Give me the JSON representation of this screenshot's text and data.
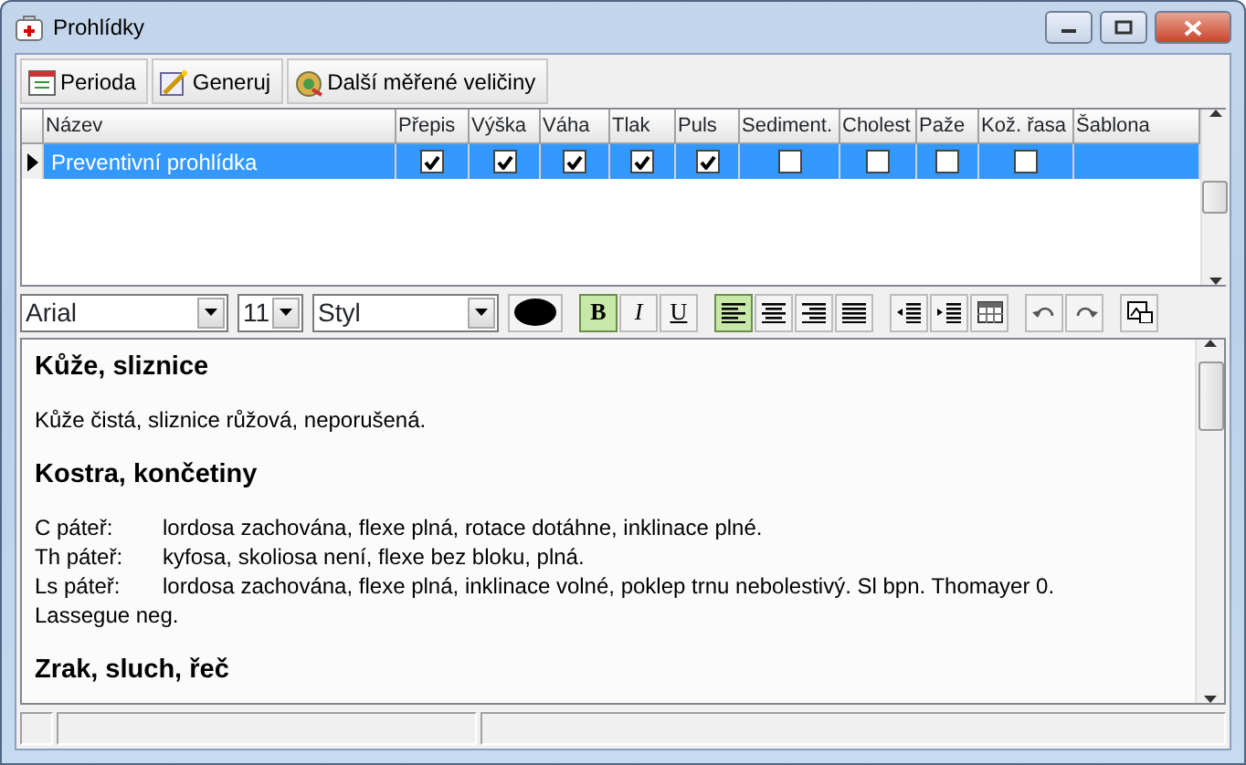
{
  "window": {
    "title": "Prohlídky"
  },
  "toolbar": [
    {
      "kind": "calendar",
      "label": "Perioda"
    },
    {
      "kind": "wand",
      "label": "Generuj"
    },
    {
      "kind": "measure",
      "label": "Další měřené veličiny"
    }
  ],
  "grid": {
    "columns": [
      {
        "label": "Název",
        "kind": "text"
      },
      {
        "label": "Přepis",
        "kind": "check"
      },
      {
        "label": "Výška",
        "kind": "check"
      },
      {
        "label": "Váha",
        "kind": "check"
      },
      {
        "label": "Tlak",
        "kind": "check"
      },
      {
        "label": "Puls",
        "kind": "check"
      },
      {
        "label": "Sediment.",
        "kind": "check"
      },
      {
        "label": "Cholest",
        "kind": "check"
      },
      {
        "label": "Paže",
        "kind": "check"
      },
      {
        "label": "Kož. řasa",
        "kind": "check"
      },
      {
        "label": "Šablona",
        "kind": "text"
      }
    ],
    "rows": [
      {
        "selected": true,
        "cells": [
          {
            "text": "Preventivní prohlídka"
          },
          {
            "checked": true
          },
          {
            "checked": true
          },
          {
            "checked": true
          },
          {
            "checked": true
          },
          {
            "checked": true
          },
          {
            "checked": false
          },
          {
            "checked": false
          },
          {
            "checked": false
          },
          {
            "checked": false
          },
          {
            "text": ""
          }
        ]
      }
    ]
  },
  "format_bar": {
    "font": "Arial",
    "size": "11",
    "style": "Styl",
    "groups": [
      [
        {
          "kind": "color",
          "color": "#000000"
        }
      ],
      [
        {
          "kind": "bold",
          "label": "B",
          "selected": true
        },
        {
          "kind": "italic",
          "label": "I",
          "selected": false
        },
        {
          "kind": "underline",
          "label": "U",
          "selected": false
        }
      ],
      [
        {
          "kind": "align-left",
          "selected": true
        },
        {
          "kind": "align-center",
          "selected": false
        },
        {
          "kind": "align-right",
          "selected": false
        },
        {
          "kind": "justify",
          "selected": false
        }
      ],
      [
        {
          "kind": "outdent"
        },
        {
          "kind": "indent"
        },
        {
          "kind": "table"
        }
      ],
      [
        {
          "kind": "undo"
        },
        {
          "kind": "redo"
        }
      ],
      [
        {
          "kind": "picture"
        }
      ]
    ]
  },
  "editor": [
    {
      "kind": "heading",
      "text": "Kůže, sliznice"
    },
    {
      "kind": "paragraph",
      "text": "Kůže čistá, sliznice růžová, neporušená."
    },
    {
      "kind": "heading",
      "text": "Kostra, končetiny"
    },
    {
      "kind": "labeled",
      "label": "C páteř:",
      "text": "lordosa zachována, flexe plná, rotace dotáhne, inklinace plné."
    },
    {
      "kind": "labeled",
      "label": "Th páteř:",
      "text": "kyfosa, skoliosa není, flexe bez bloku, plná."
    },
    {
      "kind": "labeled",
      "label": "Ls páteř:",
      "text": "lordosa zachována, flexe plná, inklinace volné, poklep trnu nebolestivý. Sl bpn. Thomayer 0."
    },
    {
      "kind": "line",
      "text": "Lassegue neg."
    },
    {
      "kind": "heading",
      "text": "Zrak, sluch, řeč"
    }
  ]
}
